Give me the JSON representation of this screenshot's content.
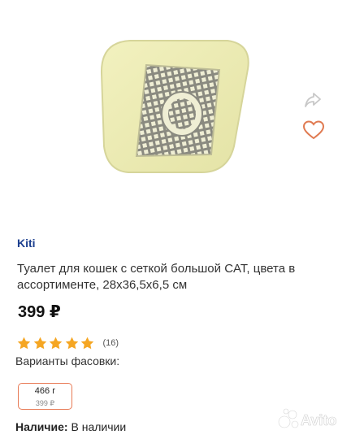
{
  "product": {
    "brand": "Kiti",
    "title": "Туалет для кошек с сеткой большой CAT, цвета в ассортименте, 28x36,5x6,5 см",
    "price": "399 ₽",
    "rating": {
      "stars": 5,
      "max": 5,
      "count": "(16)",
      "star_color": "#f5a623"
    },
    "variants_label": "Варианты фасовки:",
    "variants": [
      {
        "weight": "466 г",
        "price": "399 ₽",
        "selected": true
      }
    ],
    "availability_label": "Наличие:",
    "availability_value": "В наличии"
  },
  "actions": {
    "share_icon": "share-icon",
    "favorite_icon": "heart-icon"
  },
  "image": {
    "description_icon": "cat-litter-tray",
    "tray_color": "#eeeeb6",
    "grid_color": "#eae8cc"
  },
  "watermark": {
    "logo": "avito-logo",
    "text": "Avito"
  },
  "colors": {
    "brand_text": "#1c3f8f",
    "accent_border": "#e87a55",
    "icon_orange": "#e07b52",
    "icon_gray": "#c8c8c8"
  }
}
